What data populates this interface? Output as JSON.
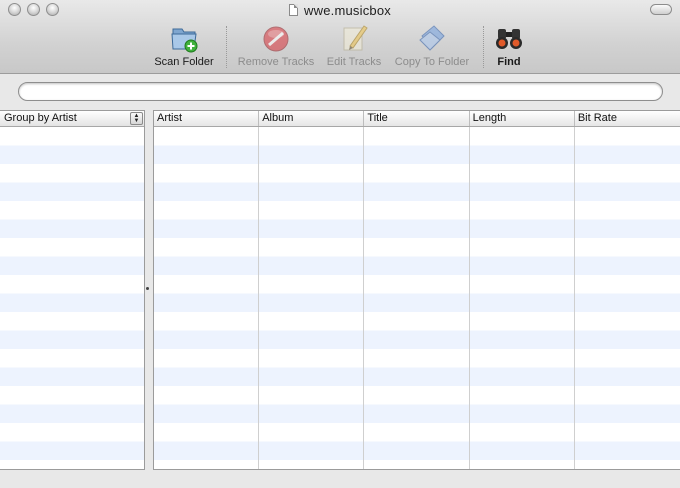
{
  "window": {
    "title": "wwe.musicbox"
  },
  "toolbar": {
    "items": [
      {
        "label": "Scan Folder",
        "icon": "scan-folder-icon",
        "enabled": true
      },
      {
        "label": "Remove Tracks",
        "icon": "remove-icon",
        "enabled": false
      },
      {
        "label": "Edit Tracks",
        "icon": "pencil-icon",
        "enabled": false
      },
      {
        "label": "Copy To Folder",
        "icon": "copy-folder-icon",
        "enabled": false
      },
      {
        "label": "Find",
        "icon": "binoculars-icon",
        "enabled": true
      }
    ]
  },
  "search": {
    "value": "",
    "placeholder": ""
  },
  "sidebar": {
    "group_by": "Group by Artist"
  },
  "table": {
    "columns": [
      "Artist",
      "Album",
      "Title",
      "Length",
      "Bit Rate"
    ],
    "rows": []
  },
  "colors": {
    "row_stripe": "#edf3fe",
    "row_base": "#ffffff"
  }
}
